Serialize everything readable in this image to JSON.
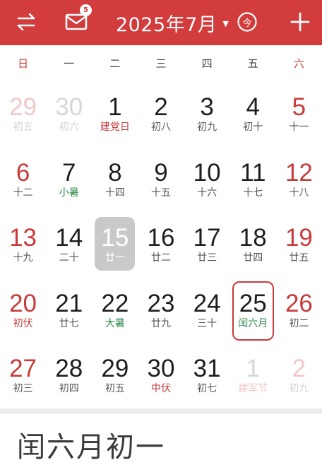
{
  "header": {
    "title": "2025年7月",
    "mail_badge": "5",
    "icons": {
      "swap": "swap-arrows-icon",
      "mail": "mail-icon",
      "today": "today-jin-icon",
      "add": "plus-icon"
    },
    "today_glyph": "今"
  },
  "colors": {
    "brand": "#d23c3c",
    "weekend": "#c73b3b",
    "solar_term": "#2c8a4a"
  },
  "weekdays": [
    "日",
    "一",
    "二",
    "三",
    "四",
    "五",
    "六"
  ],
  "weeks": [
    [
      {
        "d": "29",
        "l": "初五",
        "faded": true
      },
      {
        "d": "30",
        "l": "初六",
        "faded": true
      },
      {
        "d": "1",
        "l": "建党日",
        "festival": true
      },
      {
        "d": "2",
        "l": "初八"
      },
      {
        "d": "3",
        "l": "初九"
      },
      {
        "d": "4",
        "l": "初十"
      },
      {
        "d": "5",
        "l": "十一"
      }
    ],
    [
      {
        "d": "6",
        "l": "十二"
      },
      {
        "d": "7",
        "l": "小暑",
        "term": true
      },
      {
        "d": "8",
        "l": "十四"
      },
      {
        "d": "9",
        "l": "十五"
      },
      {
        "d": "10",
        "l": "十六"
      },
      {
        "d": "11",
        "l": "十七"
      },
      {
        "d": "12",
        "l": "十八"
      }
    ],
    [
      {
        "d": "13",
        "l": "十九"
      },
      {
        "d": "14",
        "l": "二十"
      },
      {
        "d": "15",
        "l": "廿一",
        "selected": true
      },
      {
        "d": "16",
        "l": "廿二"
      },
      {
        "d": "17",
        "l": "廿三"
      },
      {
        "d": "18",
        "l": "廿四"
      },
      {
        "d": "19",
        "l": "廿五"
      }
    ],
    [
      {
        "d": "20",
        "l": "初伏",
        "festival": true
      },
      {
        "d": "21",
        "l": "廿七"
      },
      {
        "d": "22",
        "l": "大暑",
        "term": true
      },
      {
        "d": "23",
        "l": "廿九"
      },
      {
        "d": "24",
        "l": "三十"
      },
      {
        "d": "25",
        "l": "闰六月",
        "today": true
      },
      {
        "d": "26",
        "l": "初二"
      }
    ],
    [
      {
        "d": "27",
        "l": "初三"
      },
      {
        "d": "28",
        "l": "初四"
      },
      {
        "d": "29",
        "l": "初五"
      },
      {
        "d": "30",
        "l": "中伏",
        "festival": true
      },
      {
        "d": "31",
        "l": "初七"
      },
      {
        "d": "1",
        "l": "建军节",
        "faded": true,
        "festival": true
      },
      {
        "d": "2",
        "l": "初九",
        "faded": true
      }
    ]
  ],
  "selected_lunar": "闰六月初一"
}
